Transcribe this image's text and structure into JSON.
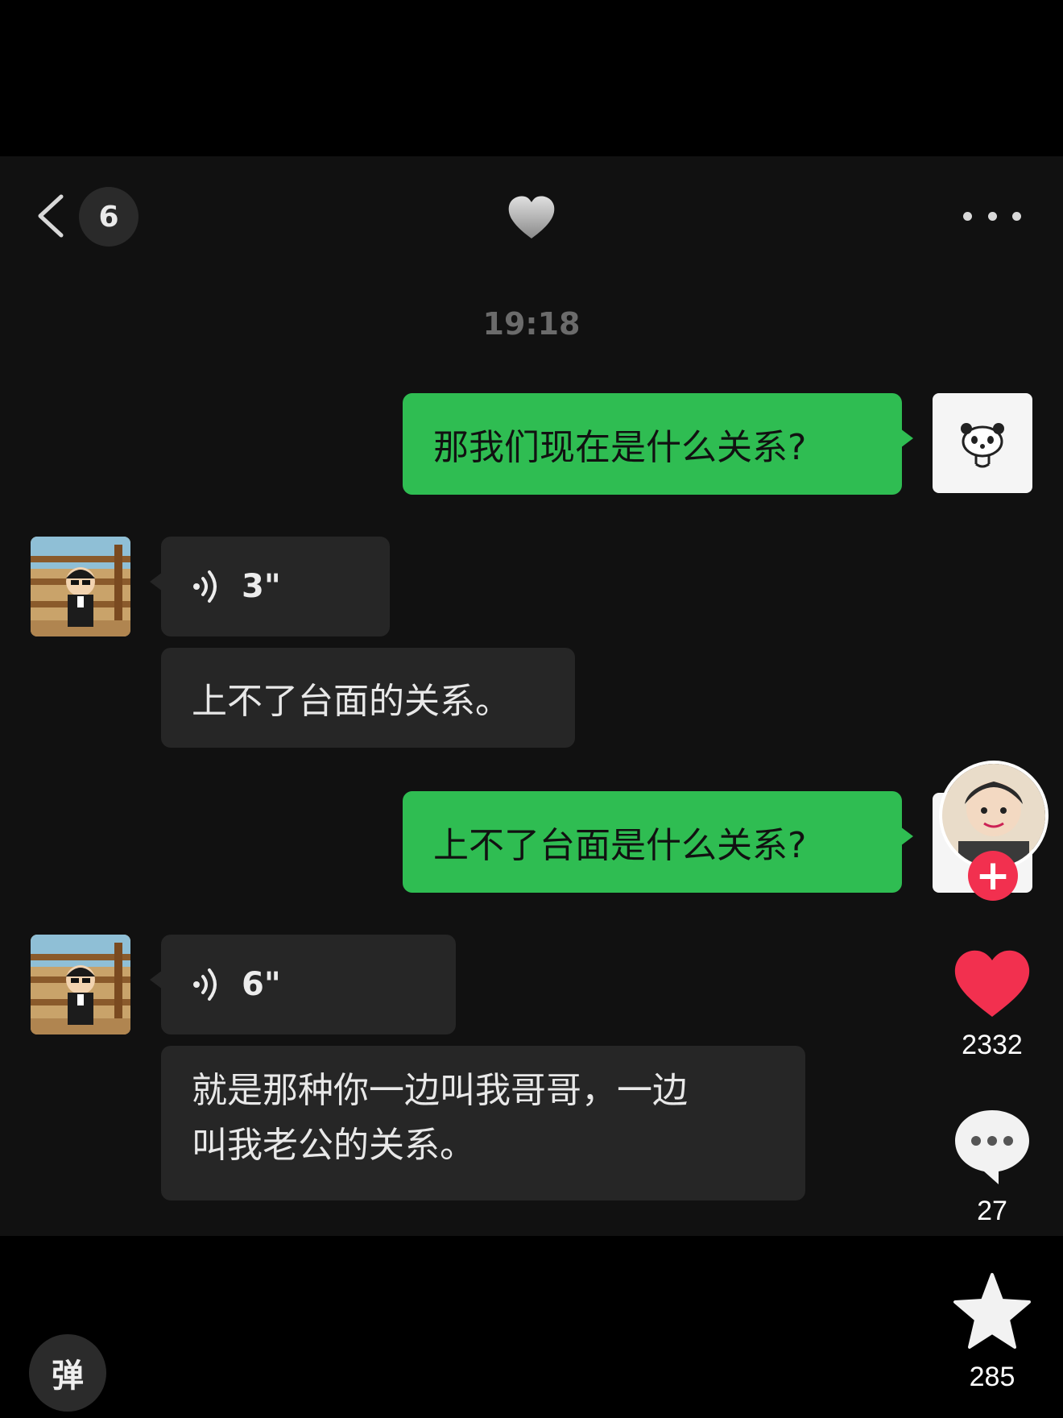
{
  "header": {
    "unread_count": "6",
    "back_icon": "chevron-left-icon",
    "title_icon": "grey-heart-icon",
    "more_icon": "ellipsis-icon"
  },
  "chat": {
    "timestamp": "19:18",
    "messages": [
      {
        "sender": "self",
        "type": "text",
        "text": "那我们现在是什么关系?"
      },
      {
        "sender": "other",
        "type": "voice",
        "duration": "3\""
      },
      {
        "sender": "other",
        "type": "text",
        "text": "上不了台面的关系。"
      },
      {
        "sender": "self",
        "type": "text",
        "text": "上不了台面是什么关系?"
      },
      {
        "sender": "other",
        "type": "voice",
        "duration": "6\""
      },
      {
        "sender": "other",
        "type": "text",
        "text": "就是那种你一边叫我哥哥，一边叫我老公的关系。"
      }
    ],
    "multi_line_text": [
      "就是那种你一边叫我哥哥，一边",
      "叫我老公的关系。"
    ]
  },
  "rail": {
    "likes": "2332",
    "comments": "27",
    "favorites": "285",
    "follow_label": "+"
  },
  "danmu": {
    "label": "弹"
  },
  "colors": {
    "outgoing_bubble": "#2fbd52",
    "incoming_bubble": "#262626",
    "like": "#f2304f",
    "background": "#111111"
  }
}
